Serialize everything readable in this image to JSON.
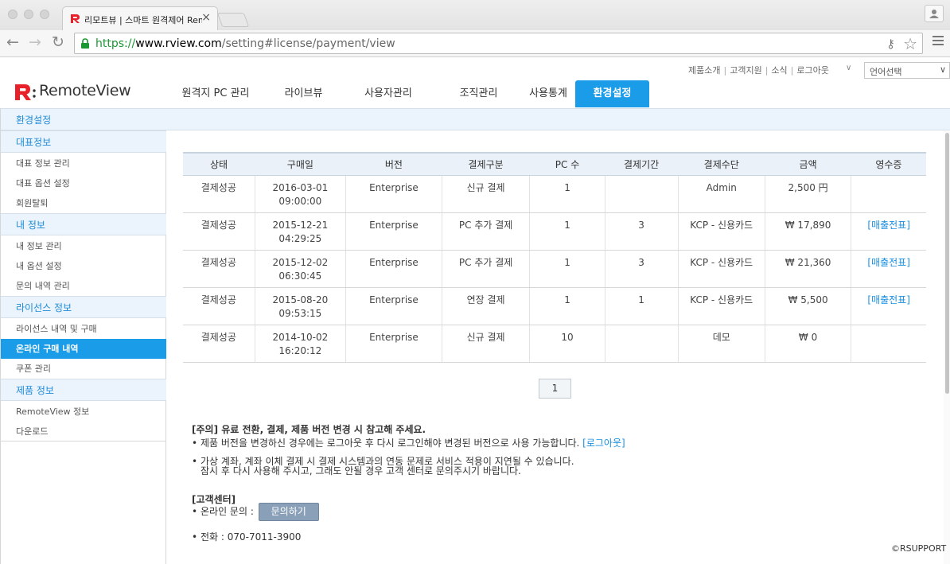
{
  "browser": {
    "tab_title": "리모트뷰 | 스마트 원격제어 RemoteView",
    "tab_close": "×",
    "url_scheme": "https://",
    "url_host": "www.rview.com",
    "url_path": "/setting#license/payment/view"
  },
  "header": {
    "util_links": [
      "제품소개",
      "고객지원",
      "소식",
      "로그아웃"
    ],
    "lang_select": "언어선택",
    "logo_text": "RemoteView",
    "brand_red": "#e8202a",
    "accent_blue": "#1a9ce8"
  },
  "nav": {
    "items": [
      "원격지 PC 관리",
      "라이브뷰",
      "사용자관리",
      "조직관리",
      "사용통계",
      "환경설정"
    ],
    "active": "환경설정"
  },
  "sidebar": {
    "title": "환경설정",
    "sections": [
      {
        "label": "대표정보",
        "items": [
          "대표 정보 관리",
          "대표 옵션 설정",
          "회원탈퇴"
        ]
      },
      {
        "label": "내 정보",
        "items": [
          "내 정보 관리",
          "내 옵션 설정",
          "문의 내역 관리"
        ]
      },
      {
        "label": "라이선스 정보",
        "items": [
          "라이선스 내역 및 구매",
          "온라인 구매 내역",
          "쿠폰 관리"
        ]
      },
      {
        "label": "제품 정보",
        "items": [
          "RemoteView 정보",
          "다운로드"
        ]
      }
    ],
    "active_item": "온라인 구매 내역"
  },
  "table": {
    "headers": [
      "상태",
      "구매일",
      "버전",
      "결제구분",
      "PC 수",
      "결제기간",
      "결제수단",
      "금액",
      "영수증"
    ],
    "rows": [
      {
        "status": "결제성공",
        "date": "2016-03-01",
        "time": "09:00:00",
        "version": "Enterprise",
        "type": "신규 결제",
        "pcs": "1",
        "period": "",
        "method": "Admin",
        "amount": "2,500 円",
        "receipt": ""
      },
      {
        "status": "결제성공",
        "date": "2015-12-21",
        "time": "04:29:25",
        "version": "Enterprise",
        "type": "PC 추가 결제",
        "pcs": "1",
        "period": "3",
        "method": "KCP - 신용카드",
        "amount": "₩ 17,890",
        "receipt": "[매출전표]"
      },
      {
        "status": "결제성공",
        "date": "2015-12-02",
        "time": "06:30:45",
        "version": "Enterprise",
        "type": "PC 추가 결제",
        "pcs": "1",
        "period": "3",
        "method": "KCP - 신용카드",
        "amount": "₩ 21,360",
        "receipt": "[매출전표]"
      },
      {
        "status": "결제성공",
        "date": "2015-08-20",
        "time": "09:53:15",
        "version": "Enterprise",
        "type": "연장 결제",
        "pcs": "1",
        "period": "1",
        "method": "KCP - 신용카드",
        "amount": "₩ 5,500",
        "receipt": "[매출전표]"
      },
      {
        "status": "결제성공",
        "date": "2014-10-02",
        "time": "16:20:12",
        "version": "Enterprise",
        "type": "신규 결제",
        "pcs": "10",
        "period": "",
        "method": "데모",
        "amount": "₩ 0",
        "receipt": ""
      }
    ]
  },
  "pagination": {
    "current": "1"
  },
  "notice": {
    "title": "[주의] 유료 전환, 결제, 제품 버전 변경 시 참고해 주세요.",
    "bullet1": "제품 버전을 변경하신 경우에는 로그아웃 후 다시 로그인해야 변경된 버전으로 사용 가능합니다.",
    "bullet1_link": "[로그아웃]",
    "bullet2_line1": "가상 계좌, 계좌 이체 결제 시 결제 시스템과의 연동 문제로 서비스 적용이 지연될 수 있습니다.",
    "bullet2_line2": "잠시 후 다시 사용해 주시고, 그래도 안될 경우 고객 센터로 문의주시기 바랍니다.",
    "support_title": "[고객센터]",
    "online_label": "온라인 문의 :",
    "inquiry_button": "문의하기",
    "phone": "전화 : 070-7011-3900"
  },
  "footer": {
    "copyright": "©RSUPPORT"
  }
}
